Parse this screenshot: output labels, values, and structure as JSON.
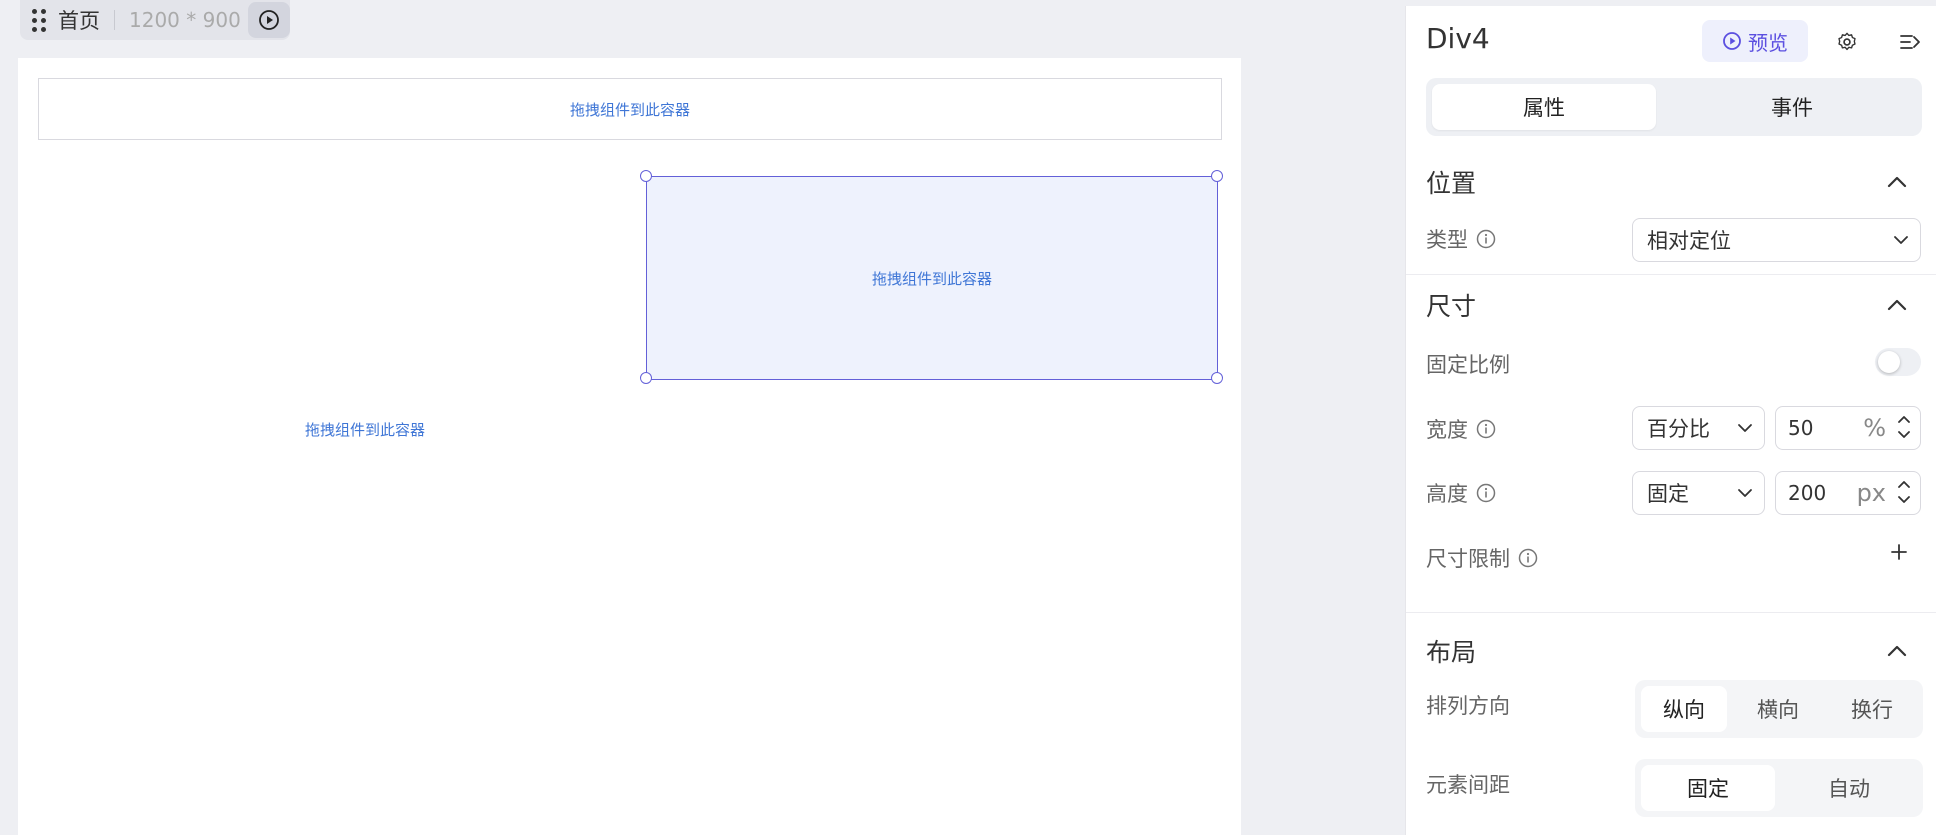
{
  "page_tab": {
    "name": "首页",
    "size": "1200 * 900"
  },
  "canvas": {
    "containers": [
      {
        "label": "拖拽组件到此容器"
      },
      {
        "label": "拖拽组件到此容器"
      },
      {
        "label": "拖拽组件到此容器"
      }
    ]
  },
  "panel": {
    "component_name": "Div4",
    "preview_label": "预览",
    "tabs": [
      "属性",
      "事件"
    ],
    "position": {
      "title": "位置",
      "type_label": "类型",
      "type_value": "相对定位"
    },
    "size": {
      "title": "尺寸",
      "lock_ratio_label": "固定比例",
      "lock_ratio_on": false,
      "width_label": "宽度",
      "width_mode": "百分比",
      "width_value": "50",
      "width_unit": "%",
      "height_label": "高度",
      "height_mode": "固定",
      "height_value": "200",
      "height_unit": "px",
      "limit_label": "尺寸限制"
    },
    "layout": {
      "title": "布局",
      "direction_label": "排列方向",
      "direction_options": [
        "纵向",
        "横向",
        "换行"
      ],
      "direction_selected": "纵向",
      "gap_label": "元素间距",
      "gap_options": [
        "固定",
        "自动"
      ],
      "gap_selected": "固定"
    }
  },
  "colors": {
    "accent": "#5b4fe0",
    "selection": "#6360d8",
    "drop_text": "#3f76d6"
  }
}
